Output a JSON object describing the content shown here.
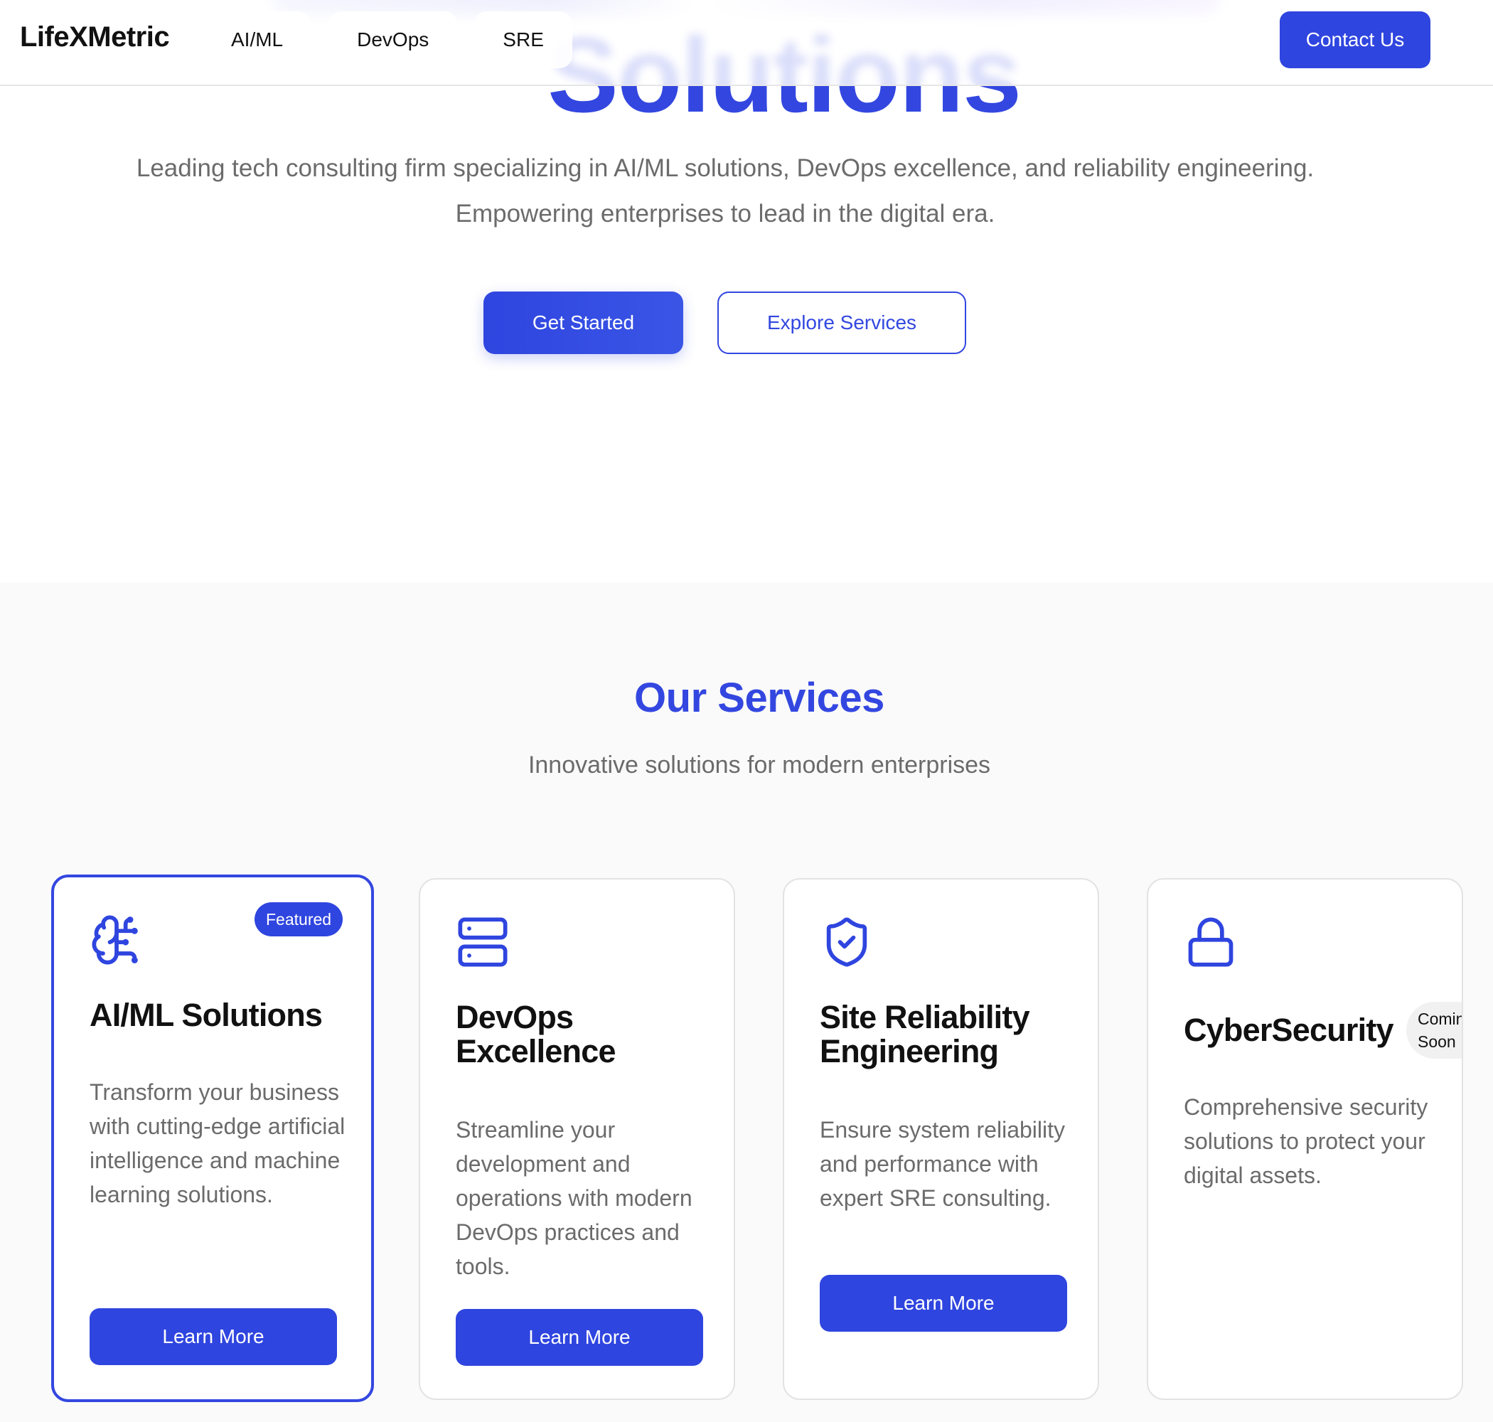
{
  "nav": {
    "logo": "LifeXMetric",
    "links": [
      "AI/ML",
      "DevOps",
      "SRE"
    ],
    "contact_label": "Contact Us"
  },
  "hero": {
    "title_fragment": "Solutions",
    "subtitle_line1": "Leading tech consulting firm specializing in AI/ML solutions, DevOps excellence, and reliability engineering.",
    "subtitle_line2": "Empowering enterprises to lead in the digital era.",
    "primary_cta": "Get Started",
    "secondary_cta": "Explore Services"
  },
  "services": {
    "heading": "Our Services",
    "subheading": "Innovative solutions for modern enterprises",
    "cards": [
      {
        "title": "AI/ML Solutions",
        "description": "Transform your business with cutting-edge artificial intelligence and machine learning solutions.",
        "button": "Learn More",
        "badge": "Featured",
        "icon": "brain-circuit-icon"
      },
      {
        "title": "DevOps Excellence",
        "description": "Streamline your development and operations with modern DevOps practices and tools.",
        "button": "Learn More",
        "icon": "server-stack-icon"
      },
      {
        "title": "Site Reliability Engineering",
        "description": "Ensure system reliability and performance with expert SRE consulting.",
        "button": "Learn More",
        "icon": "shield-check-icon"
      },
      {
        "title": "CyberSecurity",
        "description": "Comprehensive security solutions to protect your digital assets.",
        "badge": "Coming\nSoon",
        "icon": "lock-icon"
      }
    ]
  },
  "colors": {
    "accent": "#2f45df",
    "heading_blue": "#3347e0",
    "muted_text": "#6b6b6b"
  }
}
